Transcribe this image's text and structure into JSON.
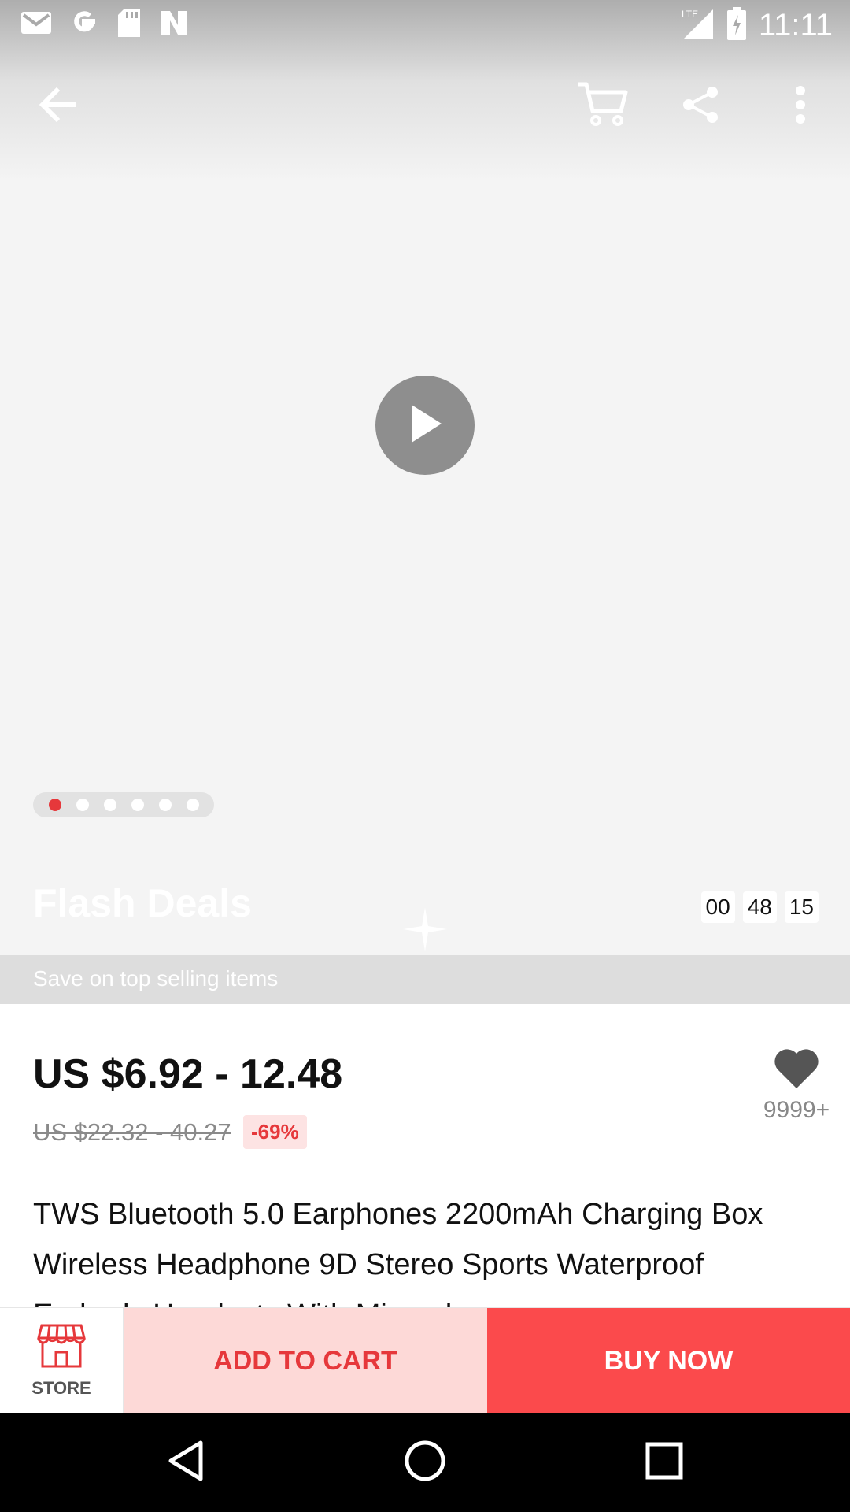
{
  "status_bar": {
    "time": "11:11",
    "network": "LTE",
    "left_icons": [
      "gmail-icon",
      "google-icon",
      "sd-card-icon",
      "news-icon"
    ]
  },
  "app_bar": {
    "icons": [
      "back-arrow-icon",
      "cart-icon",
      "share-icon",
      "more-vert-icon"
    ]
  },
  "media": {
    "carousel_count": 6,
    "active_index": 0
  },
  "flash": {
    "title": "Flash Deals",
    "subtitle": "Save on top selling items",
    "timer": {
      "hours": "00",
      "minutes": "48",
      "seconds": "15"
    }
  },
  "product": {
    "price": "US $6.92 - 12.48",
    "original_price": "US $22.32 - 40.27",
    "discount": "-69%",
    "wishlist_count": "9999+",
    "title": "TWS Bluetooth 5.0 Earphones 2200mAh Charging Box Wireless Headphone 9D Stereo Sports Waterproof Earbuds Headsets With Microphone"
  },
  "actions": {
    "store_label": "STORE",
    "add_to_cart_label": "ADD TO CART",
    "buy_now_label": "BUY NOW"
  },
  "colors": {
    "accent": "#e6383b",
    "buy_now_bg": "#fb4a4c",
    "add_to_cart_bg": "#fdd9d7"
  }
}
